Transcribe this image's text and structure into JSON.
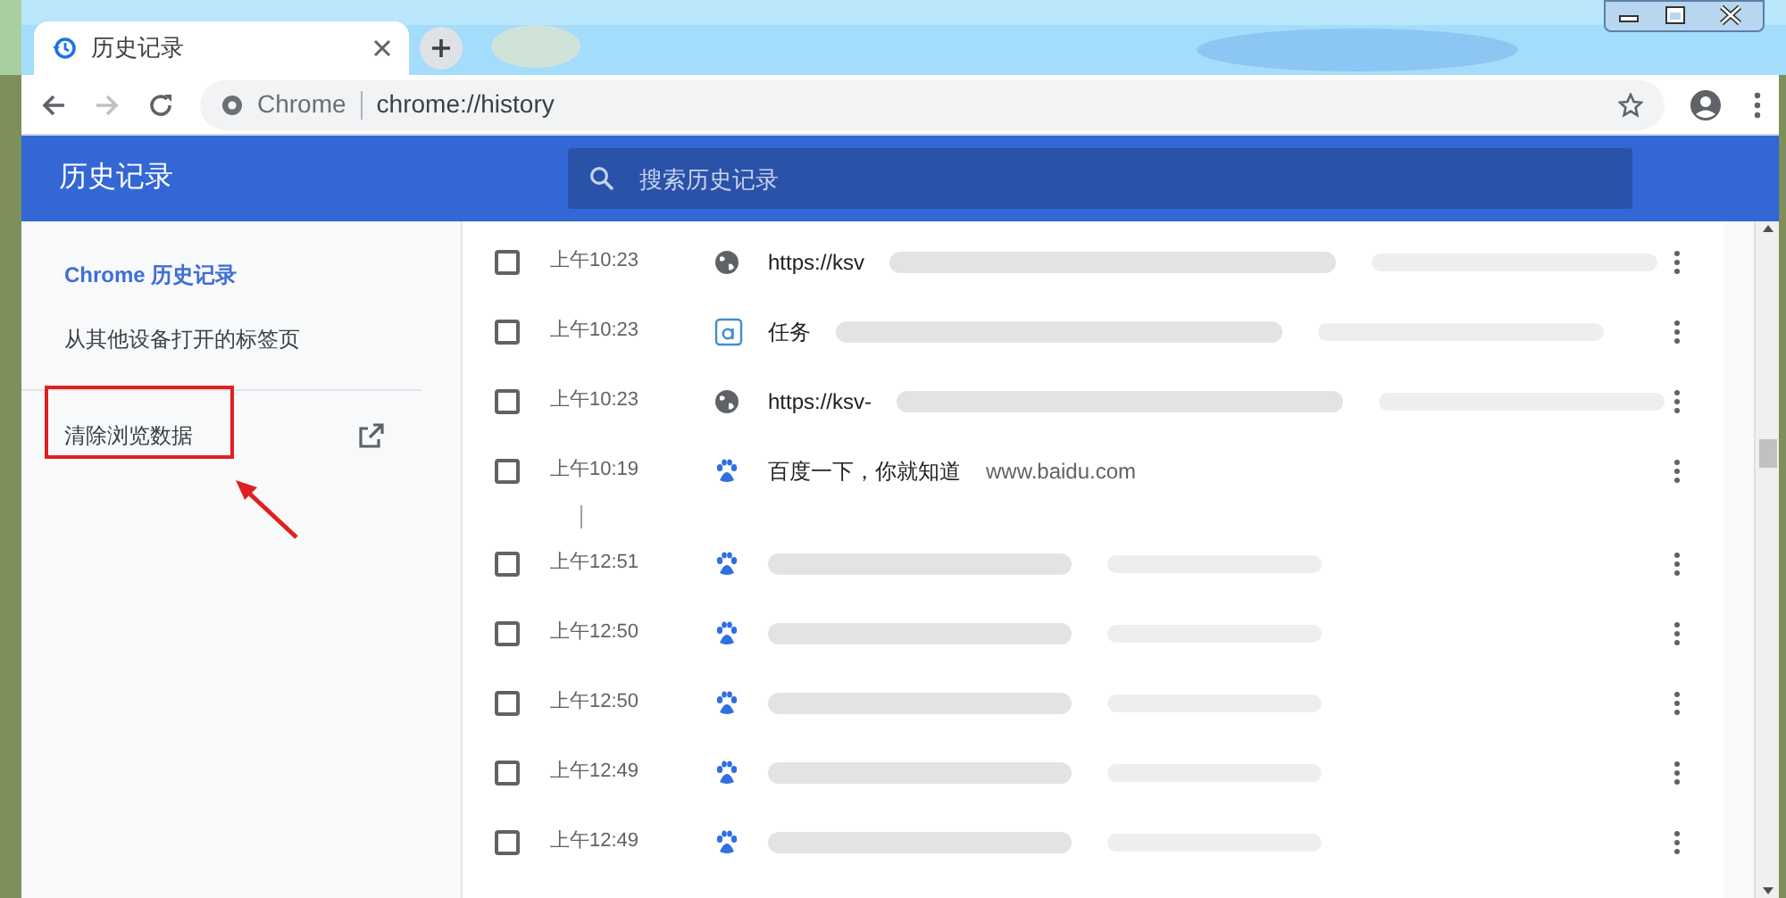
{
  "tab": {
    "title": "历史记录"
  },
  "toolbar": {
    "site_label": "Chrome",
    "url": "chrome://history"
  },
  "header": {
    "title": "历史记录",
    "search": {
      "placeholder": "搜索历史记录"
    }
  },
  "sidebar": {
    "items": [
      {
        "label": "Chrome 历史记录",
        "selected": true
      },
      {
        "label": "从其他设备打开的标签页",
        "selected": false
      }
    ],
    "clear_data": {
      "label": "清除浏览数据"
    }
  },
  "history": {
    "groups": [
      {
        "rows": [
          {
            "checked": false,
            "time": "上午10:23",
            "kind": "globe",
            "title": "https://ksv",
            "redacted": true
          },
          {
            "checked": false,
            "time": "上午10:23",
            "kind": "letter",
            "title": "任务",
            "redacted": true
          },
          {
            "checked": false,
            "time": "上午10:23",
            "kind": "globe",
            "title": "https://ksv-",
            "redacted": true
          },
          {
            "checked": false,
            "time": "上午10:19",
            "kind": "paw",
            "title": "百度一下，你就知道",
            "domain": "www.baidu.com",
            "redacted": false
          }
        ]
      },
      {
        "rows": [
          {
            "checked": false,
            "time": "上午12:51",
            "kind": "paw",
            "redacted": true
          },
          {
            "checked": false,
            "time": "上午12:50",
            "kind": "paw",
            "redacted": true
          },
          {
            "checked": false,
            "time": "上午12:50",
            "kind": "paw",
            "redacted": true
          },
          {
            "checked": false,
            "time": "上午12:49",
            "kind": "paw",
            "redacted": true
          },
          {
            "checked": false,
            "time": "上午12:49",
            "kind": "paw",
            "redacted": true
          }
        ]
      }
    ]
  },
  "annotation": {
    "highlight": true
  }
}
